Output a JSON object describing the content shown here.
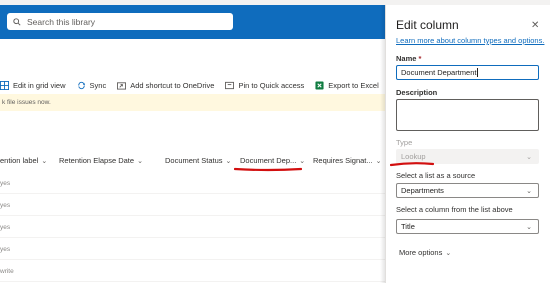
{
  "search": {
    "placeholder": "Search this library"
  },
  "commands": {
    "edit_grid": "Edit in grid view",
    "sync": "Sync",
    "add_shortcut": "Add shortcut to OneDrive",
    "pin": "Pin to Quick access",
    "export": "Export to Excel",
    "more": "···"
  },
  "banner": {
    "text": "k file issues now."
  },
  "columns": {
    "retention_label": "ention label",
    "retention_elapse": "Retention Elapse Date",
    "document_status": "Document Status",
    "document_dept": "Document Dep...",
    "requires_sig": "Requires Signat..."
  },
  "rows": [
    "yes",
    "yes",
    "yes",
    "yes",
    "yes",
    "write"
  ],
  "panel": {
    "title": "Edit column",
    "close": "✕",
    "learn_more": "Learn more about column types and options.",
    "name_label": "Name",
    "name_required": "*",
    "name_value": "Document Department",
    "description_label": "Description",
    "type_label": "Type",
    "type_value": "Lookup",
    "source_label": "Select a list as a source",
    "source_value": "Departments",
    "column_label": "Select a column from the list above",
    "column_value": "Title",
    "more_options": "More options"
  },
  "colors": {
    "header": "#0f6cbd",
    "annotation": "#d20f0f",
    "link": "#0f6cbd"
  }
}
